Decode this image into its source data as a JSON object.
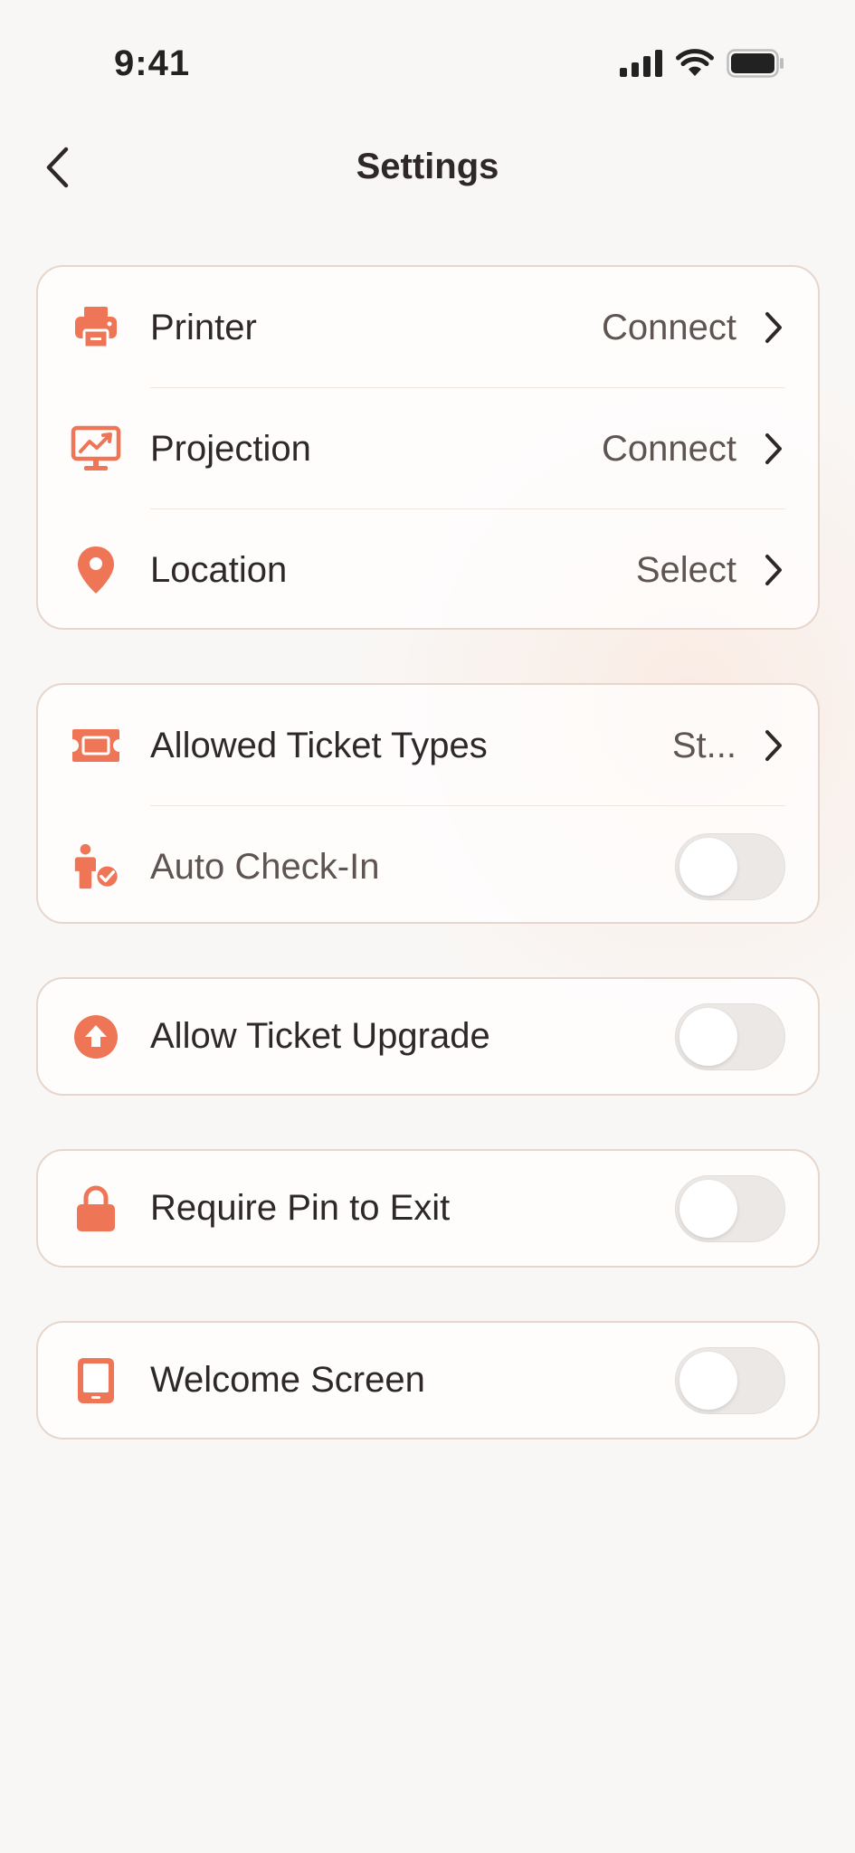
{
  "status_bar": {
    "time": "9:41",
    "icons": [
      "cellular-signal-icon",
      "wifi-icon",
      "battery-icon"
    ]
  },
  "header": {
    "title": "Settings",
    "back_icon": "chevron-left-icon"
  },
  "colors": {
    "accent": "#EE7556",
    "text": "#2E2928",
    "secondary_text": "#5E5553",
    "card_border": "#E6D6CC",
    "toggle_off": "#ECE8E6"
  },
  "groups": [
    {
      "rows": [
        {
          "icon": "printer-icon",
          "label": "Printer",
          "value": "Connect",
          "control": "chevron"
        },
        {
          "icon": "projection-icon",
          "label": "Projection",
          "value": "Connect",
          "control": "chevron"
        },
        {
          "icon": "location-pin-icon",
          "label": "Location",
          "value": "Select",
          "control": "chevron"
        }
      ]
    },
    {
      "rows": [
        {
          "icon": "ticket-icon",
          "label": "Allowed Ticket Types",
          "value": "St...",
          "control": "chevron"
        },
        {
          "icon": "person-check-icon",
          "label": "Auto Check-In",
          "control": "toggle",
          "on": false
        }
      ]
    },
    {
      "rows": [
        {
          "icon": "upgrade-arrow-icon",
          "label": "Allow Ticket Upgrade",
          "control": "toggle",
          "on": false
        }
      ]
    },
    {
      "rows": [
        {
          "icon": "lock-icon",
          "label": "Require Pin to Exit",
          "control": "toggle",
          "on": false
        }
      ]
    },
    {
      "rows": [
        {
          "icon": "tablet-icon",
          "label": "Welcome Screen",
          "control": "toggle",
          "on": false
        }
      ]
    }
  ]
}
